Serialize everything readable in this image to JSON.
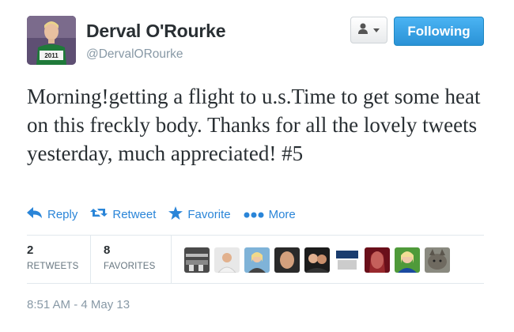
{
  "user": {
    "full_name": "Derval O'Rourke",
    "screen_name": "@DervalORourke"
  },
  "buttons": {
    "follow_label": "Following"
  },
  "tweet": {
    "text": "Morning!getting a flight to u.s.Time to get some heat on this freckly body. Thanks for all the lovely tweets yesterday, much appreciated! #5",
    "timestamp": "8:51 AM - 4 May 13"
  },
  "actions": {
    "reply": "Reply",
    "retweet": "Retweet",
    "favorite": "Favorite",
    "more": "More"
  },
  "stats": {
    "retweets_count": "2",
    "retweets_label": "RETWEETS",
    "favorites_count": "8",
    "favorites_label": "FAVORITES"
  },
  "colors": {
    "link_blue": "#2a85d8",
    "follow_button": "#2a92d6",
    "muted_gray": "#8899a6"
  }
}
